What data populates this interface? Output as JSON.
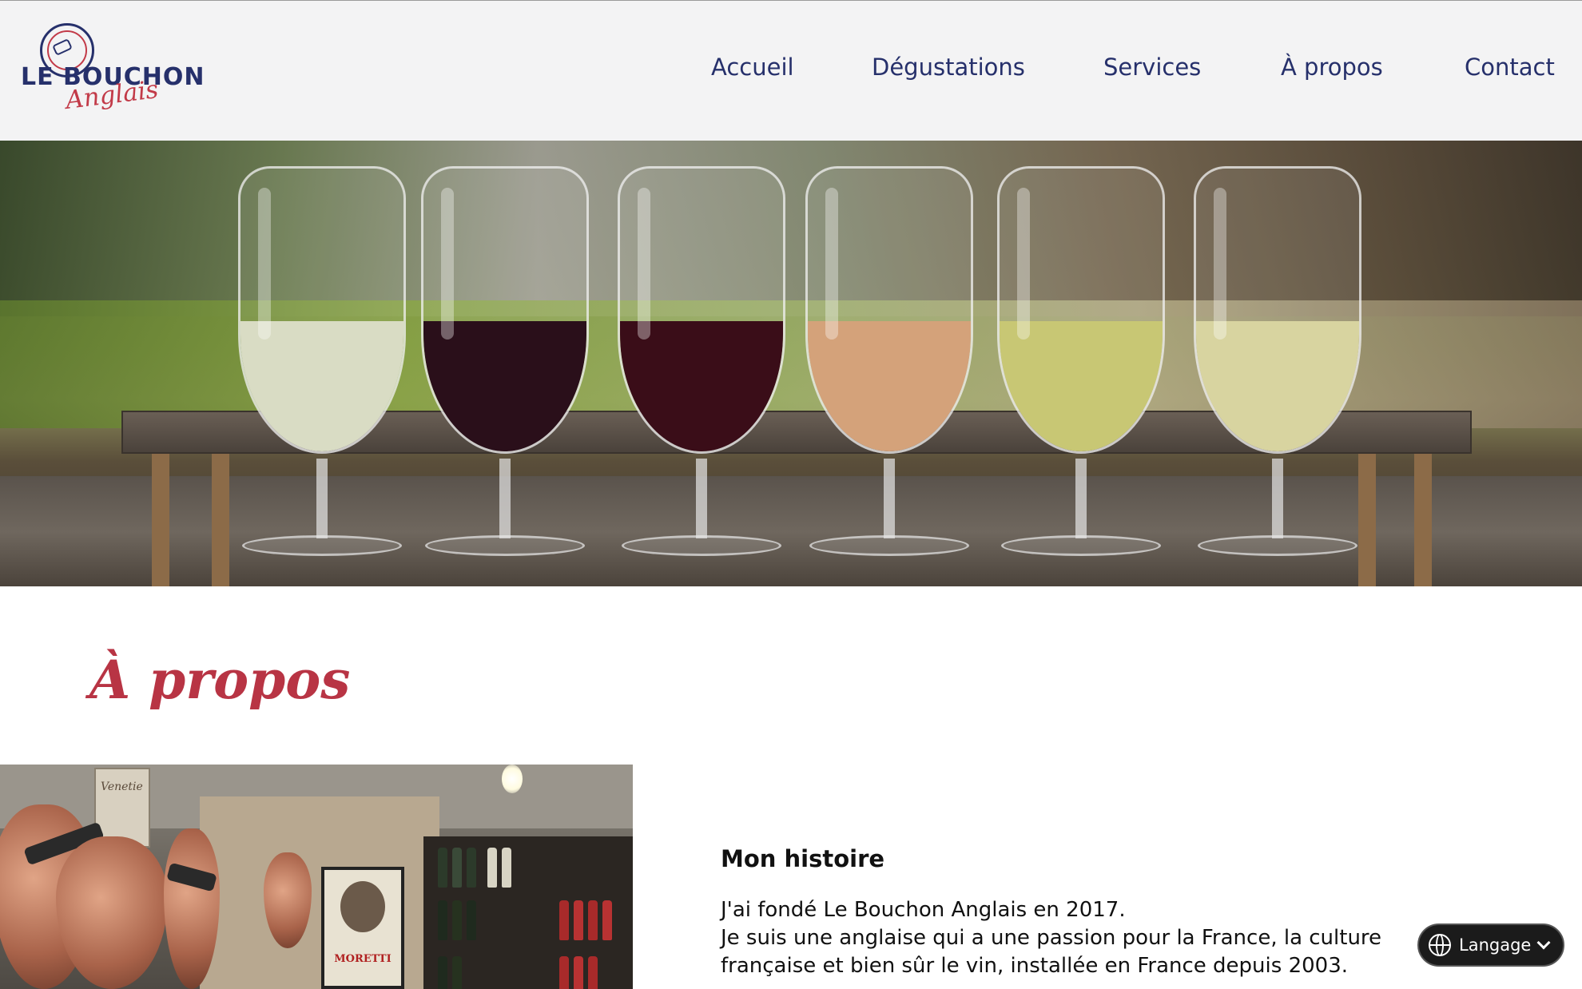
{
  "header": {
    "logo_main": "LE BOUCHON",
    "logo_script": "Anglais",
    "nav": [
      {
        "label": "Accueil"
      },
      {
        "label": "Dégustations"
      },
      {
        "label": "Services"
      },
      {
        "label": "À propos"
      },
      {
        "label": "Contact"
      }
    ]
  },
  "hero": {
    "wines": [
      {
        "color": "#d9dcc4"
      },
      {
        "color": "#2a0f1a"
      },
      {
        "color": "#3a0d18"
      },
      {
        "color": "#d4a27a"
      },
      {
        "color": "#c8c774"
      },
      {
        "color": "#d8d4a0"
      }
    ]
  },
  "about": {
    "title": "À propos",
    "cellar_poster": "MORETTI",
    "cellar_sign": "Venetie",
    "story_heading": "Mon histoire",
    "story_lines": [
      "J'ai fondé Le Bouchon Anglais en 2017.",
      "Je suis une anglaise qui a une passion pour la France, la culture",
      "française et bien sûr le vin, installée en France depuis 2003."
    ]
  },
  "language_button": {
    "label": "Langage",
    "icon": "globe-icon"
  },
  "colors": {
    "brand_navy": "#26306b",
    "brand_red": "#b83444",
    "header_bg": "#f3f3f4"
  }
}
